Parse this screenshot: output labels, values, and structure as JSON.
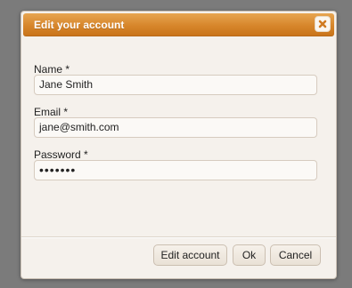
{
  "dialog": {
    "title": "Edit your account",
    "close_icon": "close-x-icon"
  },
  "form": {
    "name_label": "Name *",
    "name_value": "Jane Smith",
    "email_label": "Email *",
    "email_value": "jane@smith.com",
    "password_label": "Password *",
    "password_value": "•••••••"
  },
  "buttons": {
    "edit_account": "Edit account",
    "ok": "Ok",
    "cancel": "Cancel"
  },
  "colors": {
    "titlebar_accent": "#d7862b",
    "dialog_background": "#f5f1ec",
    "backdrop": "#7b7b7b"
  }
}
